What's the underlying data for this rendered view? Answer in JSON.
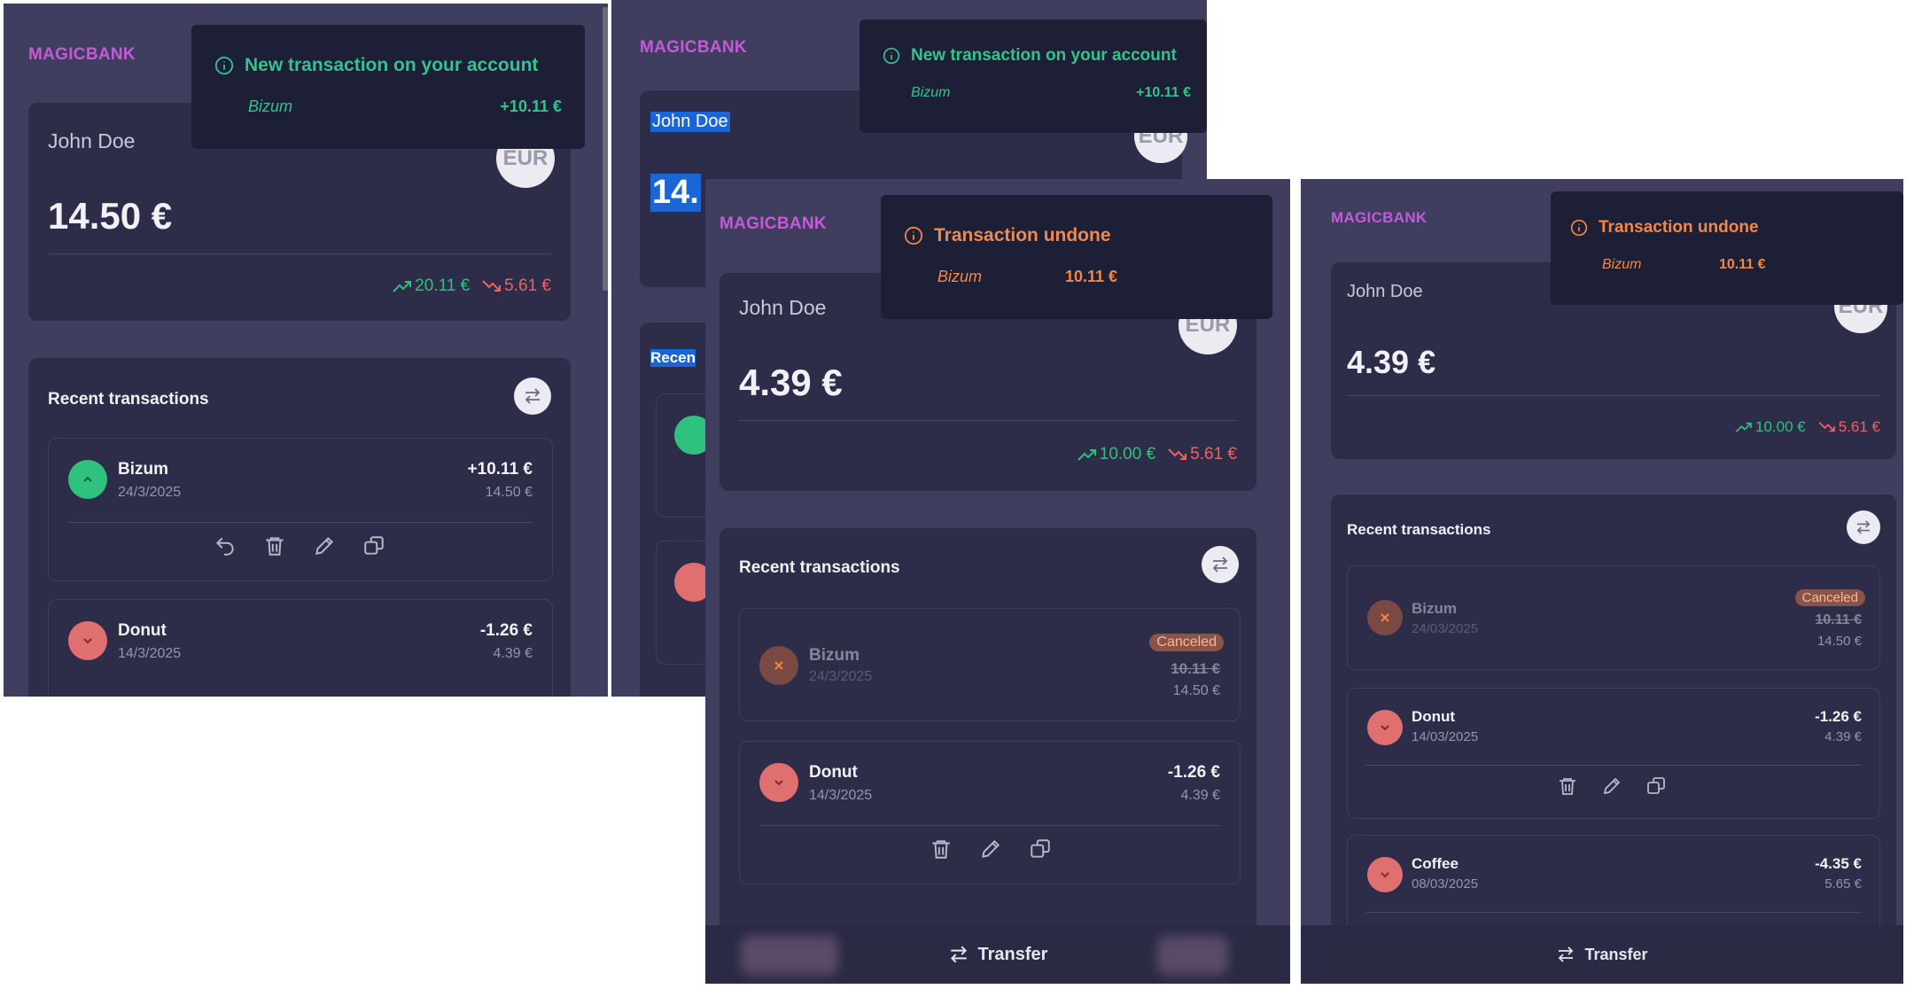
{
  "brand": "MAGICBANK",
  "user_name": "John Doe",
  "currency_badge": "EUR",
  "section_title": "Recent transactions",
  "transfer_label": "Transfer",
  "colors": {
    "accent": "#c45ad8",
    "income": "#2ec27e",
    "expense": "#f06262",
    "warning": "#f1874a",
    "background": "#403e5f",
    "card": "#2d2c49"
  },
  "panel1": {
    "balance": "14.50 €",
    "income": "20.11 €",
    "expense": "5.61 €",
    "toast": {
      "title": "New transaction on your account",
      "source": "Bizum",
      "amount": "+10.11 €"
    },
    "tx": [
      {
        "title": "Bizum",
        "date": "24/3/2025",
        "amount": "+10.11 €",
        "balance": "14.50 €"
      },
      {
        "title": "Donut",
        "date": "14/3/2025",
        "amount": "-1.26 €",
        "balance": "4.39 €"
      }
    ]
  },
  "panel2": {
    "balance_partial": "14.",
    "section_partial": "Recen",
    "toast": {
      "title": "New transaction on your account",
      "source": "Bizum",
      "amount": "+10.11 €"
    }
  },
  "panel3": {
    "balance": "4.39 €",
    "income": "10.00 €",
    "expense": "5.61 €",
    "toast": {
      "title": "Transaction undone",
      "source": "Bizum",
      "amount": "10.11 €"
    },
    "tx": [
      {
        "title": "Bizum",
        "date": "24/3/2025",
        "status": "Canceled",
        "amount": "10.11 €",
        "balance": "14.50 €"
      },
      {
        "title": "Donut",
        "date": "14/3/2025",
        "amount": "-1.26 €",
        "balance": "4.39 €"
      }
    ]
  },
  "panel4": {
    "balance": "4.39 €",
    "income": "10.00 €",
    "expense": "5.61 €",
    "toast": {
      "title": "Transaction undone",
      "source": "Bizum",
      "amount": "10.11 €"
    },
    "tx": [
      {
        "title": "Bizum",
        "date": "24/03/2025",
        "status": "Canceled",
        "amount": "10.11 €",
        "balance": "14.50 €"
      },
      {
        "title": "Donut",
        "date": "14/03/2025",
        "amount": "-1.26 €",
        "balance": "4.39 €"
      },
      {
        "title": "Coffee",
        "date": "08/03/2025",
        "amount": "-4.35 €",
        "balance": "5.65 €"
      }
    ]
  }
}
